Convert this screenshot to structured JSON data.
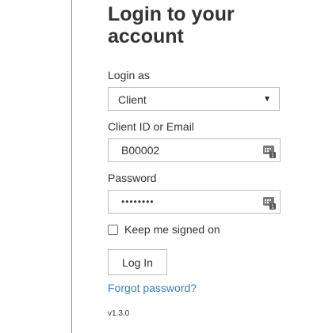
{
  "form": {
    "title": "Login to your account",
    "login_as_label": "Login as",
    "login_as_selected": "Client",
    "client_id_label": "Client ID or Email",
    "client_id_value": "B00002",
    "password_label": "Password",
    "password_value": "••••••••",
    "keep_signed_in_label": "Keep me signed on",
    "keep_signed_in_checked": false,
    "login_button": "Log In",
    "forgot_password": "Forgot password?",
    "version": "v1.3.0"
  },
  "icons": {
    "select_caret": "caret-down-icon",
    "field_icon": "password-manager-icon"
  },
  "colors": {
    "link": "#3f7fbf",
    "text": "#333333",
    "border": "#bdbdbd"
  }
}
